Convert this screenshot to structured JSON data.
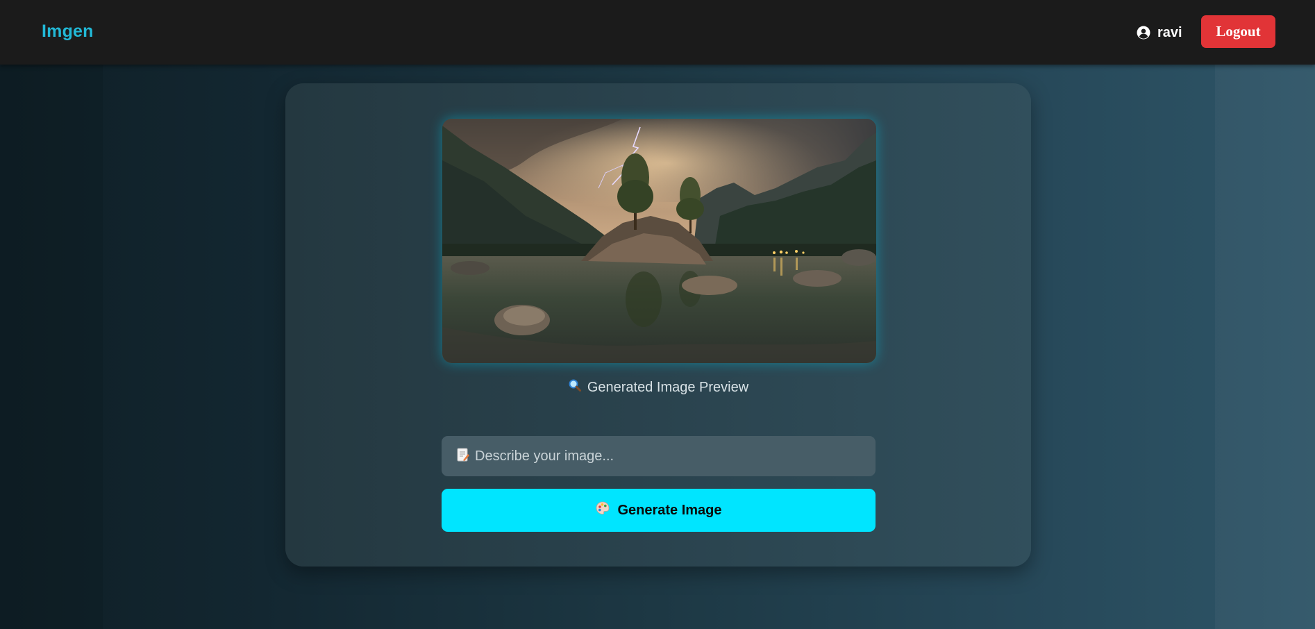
{
  "navbar": {
    "brand": "Imgen",
    "username": "ravi",
    "logout_label": "Logout",
    "icons": {
      "user": "user-circle-icon"
    }
  },
  "preview": {
    "image_description": "generated-landscape-image",
    "label": "Generated Image Preview",
    "label_icon": "magnifier-icon"
  },
  "prompt": {
    "placeholder": "Describe your image...",
    "value": "",
    "icon": "memo-icon"
  },
  "generate": {
    "label": "Generate Image",
    "icon": "palette-icon"
  },
  "colors": {
    "brand": "#22b8d6",
    "navbar_bg": "#1b1b1b",
    "logout_bg": "#e13437",
    "generate_bg": "#00e5ff",
    "input_bg": "#475d67"
  }
}
